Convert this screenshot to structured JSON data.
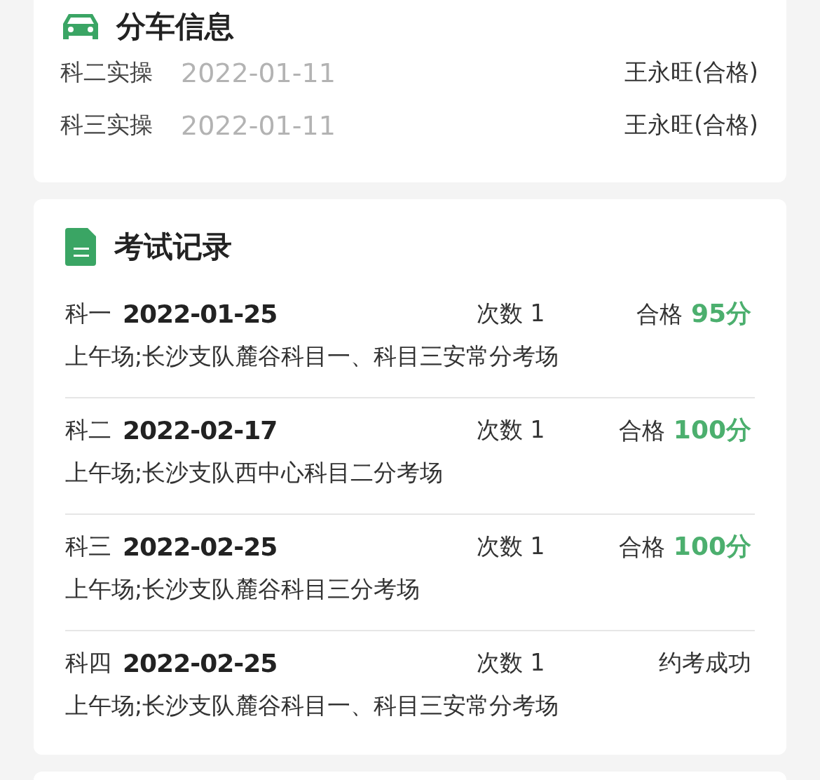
{
  "assignment": {
    "title": "分车信息",
    "rows": [
      {
        "label": "科二实操",
        "date": "2022-01-11",
        "coach": "王永旺(合格)"
      },
      {
        "label": "科三实操",
        "date": "2022-01-11",
        "coach": "王永旺(合格)"
      }
    ]
  },
  "exams": {
    "title": "考试记录",
    "records": [
      {
        "subject": "科一",
        "date": "2022-01-25",
        "attempts": "次数 1",
        "result": "合格",
        "score": "95分",
        "place": "上午场;长沙支队麓谷科目一、科目三安常分考场"
      },
      {
        "subject": "科二",
        "date": "2022-02-17",
        "attempts": "次数 1",
        "result": "合格",
        "score": "100分",
        "place": "上午场;长沙支队西中心科目二分考场"
      },
      {
        "subject": "科三",
        "date": "2022-02-25",
        "attempts": "次数 1",
        "result": "合格",
        "score": "100分",
        "place": "上午场;长沙支队麓谷科目三分考场"
      },
      {
        "subject": "科四",
        "date": "2022-02-25",
        "attempts": "次数 1",
        "result": "约考成功",
        "place": "上午场;长沙支队麓谷科目一、科目三安常分考场"
      }
    ]
  }
}
